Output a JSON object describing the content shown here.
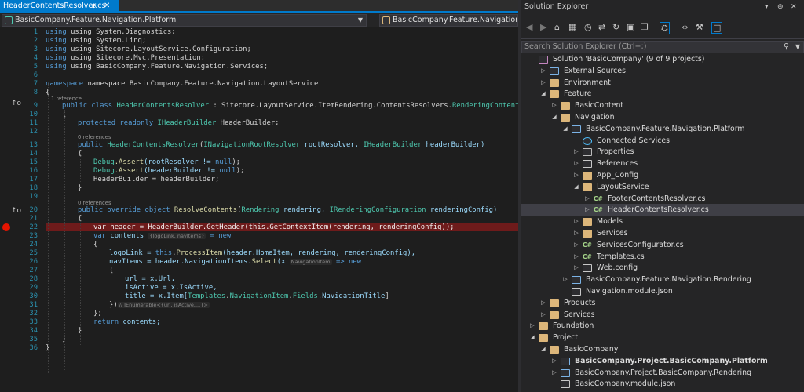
{
  "editor": {
    "tab_label": "HeaderContentsResolver.cs",
    "pin_icon": "pin-icon",
    "close_icon": "close-icon",
    "nav_project": "BasicCompany.Feature.Navigation.Platform",
    "nav_type": "BasicCompany.Feature.Navigation.Layou",
    "lines": [
      "1",
      "2",
      "3",
      "4",
      "5",
      "6",
      "7",
      "8",
      "9",
      "10",
      "11",
      "12",
      "13",
      "14",
      "15",
      "16",
      "17",
      "18",
      "19",
      "20",
      "21",
      "22",
      "23",
      "24",
      "25",
      "26",
      "27",
      "28",
      "29",
      "30",
      "31",
      "32",
      "33",
      "34",
      "35",
      "36"
    ],
    "refs": {
      "r9": "1 reference",
      "r13": "0 references",
      "r20": "0 references"
    },
    "code": {
      "l1": "using System.Diagnostics;",
      "l2": "using System.Linq;",
      "l3": "using Sitecore.LayoutService.Configuration;",
      "l4": "using Sitecore.Mvc.Presentation;",
      "l5": "using BasicCompany.Feature.Navigation.Services;",
      "l7": "namespace BasicCompany.Feature.Navigation.LayoutService",
      "l8": "{",
      "l9a": "public class ",
      "l9b": "HeaderContentsResolver",
      " l9c": " : Sitecore.LayoutService.ItemRendering.ContentsResolvers.",
      "l9d": "RenderingContentsResolver",
      "l10": "{",
      "l11a": "protected readonly ",
      "l11b": "IHeaderBuilder",
      "l11c": " HeaderBuilder;",
      "l13a": "public ",
      "l13b": "HeaderContentsResolver",
      "l13c": "(",
      "l13d": "INavigationRootResolver",
      "l13e": " rootResolver, ",
      "l13f": "IHeaderBuilder",
      "l13g": " headerBuilder)",
      "l14": "{",
      "l15a": "Debug",
      "l15b": ".Assert",
      "l15c": "(rootResolver != ",
      "l15d": "null",
      "l15e": ");",
      "l16a": "Debug",
      "l16b": ".Assert",
      "l16c": "(headerBuilder != ",
      "l16d": "null",
      "l16e": ");",
      "l17": "HeaderBuilder = headerBuilder;",
      "l18": "}",
      "l20a": "public override object ",
      "l20b": "ResolveContents",
      "l20c": "(",
      "l20d": "Rendering",
      "l20e": " rendering, ",
      "l20f": "IRenderingConfiguration",
      "l20g": " renderingConfig)",
      "l21": "{",
      "l22": "var header = HeaderBuilder.GetHeader(this.GetContextItem(rendering, renderingConfig));",
      "l23a": "var ",
      "l23b": "contents",
      "l23h": "{logoLink, navItems}",
      "l23c": " = new",
      "l24": "{",
      "l25a": "logoLink = ",
      "l25b": "this",
      "l25c": ".",
      "l25d": "ProcessItem",
      "l25e": "(header.HomeItem, rendering, renderingConfig),",
      "l26a": "navItems = header.NavigationItems.",
      "l26b": "Select",
      "l26c": "(x ",
      "l26h": "NavigationItem",
      "l26d": " => new",
      "l27": "{",
      "l28": "url = x.Url,",
      "l29": "isActive = x.IsActive,",
      "l30a": "title = x.Item[",
      "l30b": "Templates",
      "l30c": ".",
      "l30d": "NavigationItem",
      "l30e": ".",
      "l30f": "Fields",
      "l30g": ".",
      "l30i": "NavigationTitle",
      "l30j": "]",
      "l31a": "})",
      "l31h": "// IEnumerable<{url, isActive,...}>",
      "l32": "};",
      "l33a": "return ",
      "l33b": "contents;",
      "l34": "}",
      "l35": "}",
      "l36": "}"
    }
  },
  "solution_explorer": {
    "title": "Solution Explorer",
    "search_placeholder": "Search Solution Explorer (Ctrl+;)",
    "items": [
      {
        "label": "Solution 'BasicCompany' (9 of 9 projects)",
        "icon": "solution-icon"
      },
      {
        "label": "External Sources",
        "icon": "external-icon"
      },
      {
        "label": "Environment",
        "icon": "folder-icon"
      },
      {
        "label": "Feature",
        "icon": "folder-icon"
      },
      {
        "label": "BasicContent",
        "icon": "folder-icon"
      },
      {
        "label": "Navigation",
        "icon": "folder-icon"
      },
      {
        "label": "BasicCompany.Feature.Navigation.Platform",
        "icon": "project-icon"
      },
      {
        "label": "Connected Services",
        "icon": "globe-icon"
      },
      {
        "label": "Properties",
        "icon": "wrench-icon"
      },
      {
        "label": "References",
        "icon": "references-icon"
      },
      {
        "label": "App_Config",
        "icon": "folder-icon"
      },
      {
        "label": "LayoutService",
        "icon": "folder-icon"
      },
      {
        "label": "FooterContentsResolver.cs",
        "icon": "csharp-file-icon"
      },
      {
        "label": "HeaderContentsResolver.cs",
        "icon": "csharp-file-icon"
      },
      {
        "label": "Models",
        "icon": "folder-icon"
      },
      {
        "label": "Services",
        "icon": "folder-icon"
      },
      {
        "label": "ServicesConfigurator.cs",
        "icon": "csharp-file-icon"
      },
      {
        "label": "Templates.cs",
        "icon": "csharp-file-icon"
      },
      {
        "label": "Web.config",
        "icon": "config-file-icon"
      },
      {
        "label": "BasicCompany.Feature.Navigation.Rendering",
        "icon": "project-icon"
      },
      {
        "label": "Navigation.module.json",
        "icon": "json-file-icon"
      },
      {
        "label": "Products",
        "icon": "folder-icon"
      },
      {
        "label": "Services",
        "icon": "folder-icon"
      },
      {
        "label": "Foundation",
        "icon": "folder-icon"
      },
      {
        "label": "Project",
        "icon": "folder-icon"
      },
      {
        "label": "BasicCompany",
        "icon": "folder-icon"
      },
      {
        "label": "BasicCompany.Project.BasicCompany.Platform",
        "icon": "project-icon"
      },
      {
        "label": "BasicCompany.Project.BasicCompany.Rendering",
        "icon": "project-icon"
      },
      {
        "label": "BasicCompany.module.json",
        "icon": "json-file-icon"
      }
    ]
  },
  "colors": {
    "accent": "#007acc",
    "breakpoint": "#e51400",
    "selection": "#3f3f46"
  }
}
